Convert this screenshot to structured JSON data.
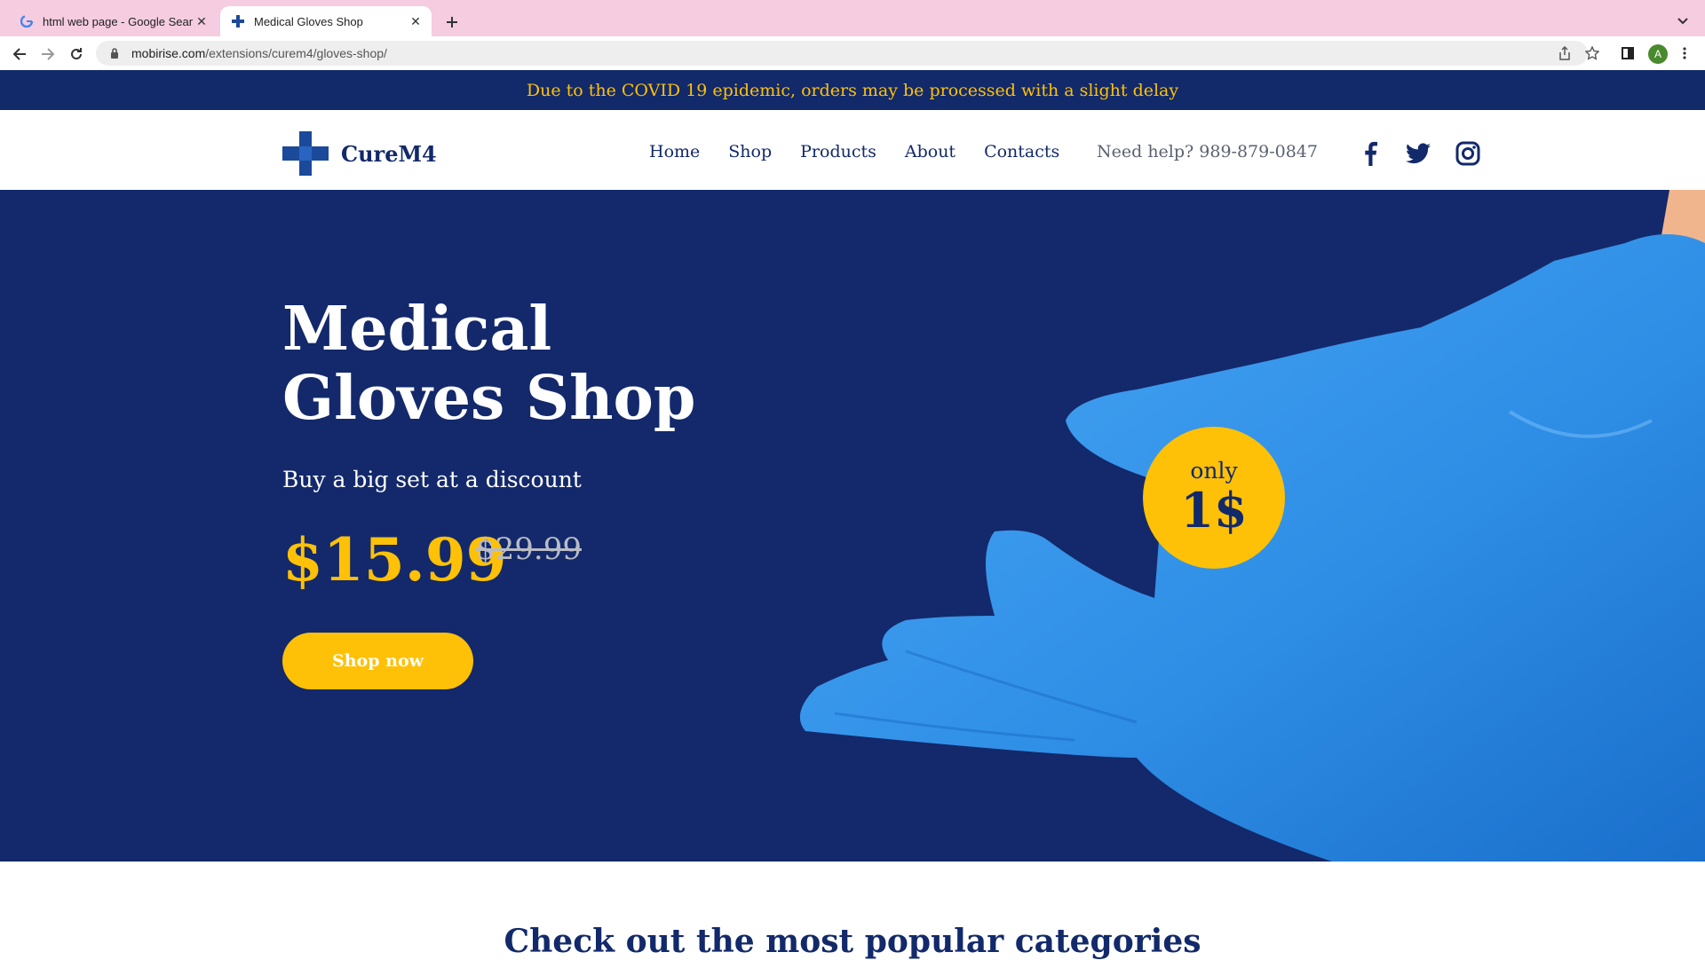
{
  "browser": {
    "tabs": [
      {
        "title": "html web page - Google Search",
        "favicon": "google-icon",
        "active": false
      },
      {
        "title": "Medical Gloves Shop",
        "favicon": "medical-cross-icon",
        "active": true
      }
    ],
    "url_domain": "mobirise.com",
    "url_path": "/extensions/curem4/gloves-shop/",
    "profile_initial": "A"
  },
  "notice": {
    "text": "Due to the COVID 19 epidemic, orders may be processed with a slight delay"
  },
  "header": {
    "brand": "CureM4",
    "nav": [
      "Home",
      "Shop",
      "Products",
      "About",
      "Contacts"
    ],
    "help_text": "Need help? 989-879-0847",
    "social": [
      "facebook-icon",
      "twitter-icon",
      "instagram-icon"
    ]
  },
  "hero": {
    "title_line1": "Medical",
    "title_line2": "Gloves Shop",
    "subtitle": "Buy a big set at a discount",
    "price_new": "$15.99",
    "price_old": "$29.99",
    "cta_label": "Shop now",
    "badge_top": "only",
    "badge_value": "1$"
  },
  "section": {
    "categories_title": "Check out the most popular categories"
  },
  "colors": {
    "navy": "#12296a",
    "accent": "#ffc107",
    "glove": "#2f8fe6",
    "tabbar": "#f5cce0"
  }
}
